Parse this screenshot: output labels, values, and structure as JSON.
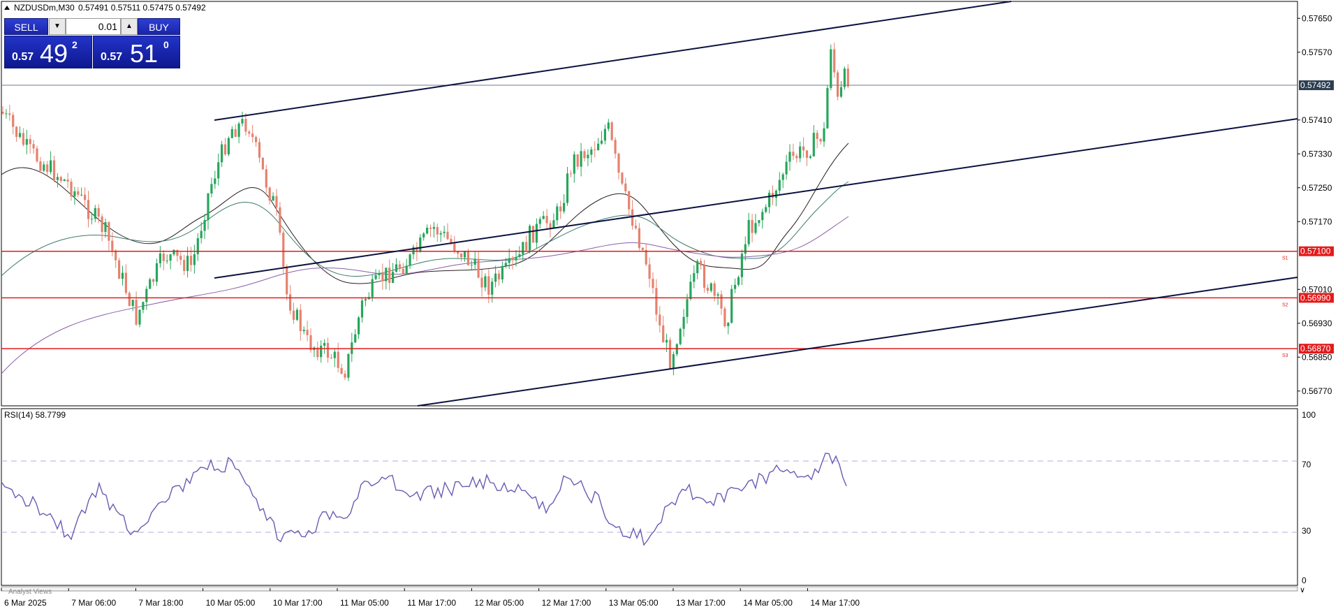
{
  "window": {
    "symbol_header": "NZDUSDm,M30",
    "ohlc": "0.57491 0.57511 0.57475 0.57492",
    "menu_icon": "triangle-up-icon"
  },
  "trade_panel": {
    "sell_label": "SELL",
    "buy_label": "BUY",
    "lot_value": "0.01",
    "sell_price": {
      "prefix": "0.57",
      "big": "49",
      "sup": "2"
    },
    "buy_price": {
      "prefix": "0.57",
      "big": "51",
      "sup": "0"
    }
  },
  "price_axis": {
    "ticks": [
      "0.57650",
      "0.57570",
      "0.57410",
      "0.57330",
      "0.57250",
      "0.57170",
      "0.57010",
      "0.56930",
      "0.56850",
      "0.56770"
    ],
    "current_price_label": "0.57492",
    "levels": [
      {
        "label": "0.57100",
        "tag": "S1",
        "value": 0.571
      },
      {
        "label": "0.56990",
        "tag": "S2",
        "value": 0.5699
      },
      {
        "label": "0.56870",
        "tag": "S3",
        "value": 0.5687
      }
    ],
    "current_value": 0.57492,
    "level_color": "#e31b1b",
    "current_label_bg": "#2c3e50"
  },
  "rsi": {
    "title": "RSI(14) 58.7799",
    "ticks": [
      "100",
      "70",
      "30",
      "0"
    ],
    "line_color": "#6b5bb3"
  },
  "time_axis": {
    "labels": [
      "6 Mar 2025",
      "7 Mar 06:00",
      "7 Mar 18:00",
      "10 Mar 05:00",
      "10 Mar 17:00",
      "11 Mar 05:00",
      "11 Mar 17:00",
      "12 Mar 05:00",
      "12 Mar 17:00",
      "13 Mar 05:00",
      "13 Mar 17:00",
      "14 Mar 05:00",
      "14 Mar 17:00"
    ]
  },
  "tab_label": "Analyst Views",
  "colors": {
    "bull": "#26a65b",
    "bear": "#e5826e",
    "channel": "#0b1140",
    "ma_dark": "#2b2020",
    "ma_green": "#3b7a6a",
    "ma_purple": "#8a5fa8"
  }
}
